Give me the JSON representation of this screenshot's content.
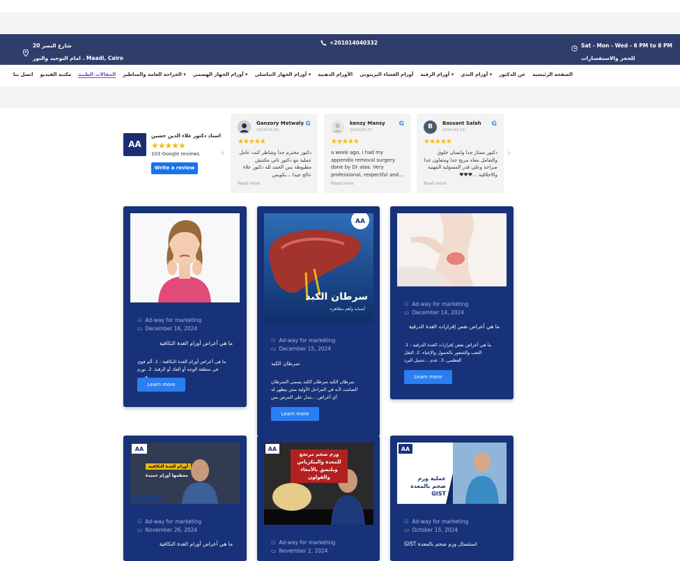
{
  "topbar": {
    "address_line1": "شارع النصر 20",
    "address_line2": "امام التوحيد والنور . Maadi, Cairo",
    "phone": "+201014040332",
    "hours_line1": "Sat - Mon - Wed - 6 PM to 8 PM",
    "hours_line2": "للحجز والاستفسارات"
  },
  "nav": {
    "items": [
      "الصفحة الرئيسية",
      "عن الدكتور",
      "أورام الثدي",
      "أورام الرقبة",
      "أورام الغشاء البريتوني",
      "الأورام الدهنية",
      "أورام الجهاز التناسلي",
      "أورام الجهاز الهضمي",
      "الجراحة العامة والمناظير",
      "المقالات الطبية",
      "مكتبة الفيديو",
      "اتصل بنا"
    ]
  },
  "reviews": {
    "logo_text": "AA",
    "business_name": "استاذ دكتور علاء الدين حسين",
    "stars": "★★★★★",
    "count": "103 Google reviews",
    "write_label": "Write a review",
    "prev_icon": "‹",
    "next_icon": "›",
    "cards": [
      {
        "avatar": "",
        "name": "Ganzory Metwaly",
        "date": "2024-03-30",
        "stars": "★★★★★",
        "text": "دكتور محترم جدا وشاطر كنت عامل عملية مع دكتور تاني مكنتش مظبوطة بس الحمد لله دكتور علاء عالج جيدا ...بكويس",
        "read": "Read more",
        "rtl": true
      },
      {
        "avatar": "",
        "name": "kenzy Mansy",
        "date": "2024-03-27",
        "stars": "★★★★★",
        "text": "a week ago, i had my appendix removal surgery done by Dr alaa. Very professional, respectful and...",
        "read": "Read more",
        "rtl": false
      },
      {
        "avatar": "B",
        "name": "Bassant Salah",
        "date": "2024-02-23",
        "stars": "★★★★★",
        "text": "دكتور ممتاز جدا وانسان خلوق والتعامل معاه مريح جدا ومتعاون جدا صراحة وعلي قدر المسؤلية المهنية والاخلاقية ...♥♥♥",
        "read": "Read more",
        "rtl": true
      }
    ]
  },
  "posts": [
    {
      "author": "Ad-way for marketing",
      "date": "December 16, 2024",
      "title": "ما هي أعراض أورام الغدة النكافية",
      "excerpt": "ما هي أعراض أورام الغدة النكافية : 1. ألم قوي في منطقة الوجه أو الفك أو الرقبة. 2. تورم في...",
      "button": "Learn more"
    },
    {
      "author": "Ad-way for marketing",
      "date": "December 15, 2024",
      "title": "سرطان الكبد",
      "excerpt": "سرطان الكبد سرطان الكبد يسمى السرطان الصامت لأنه في المراحل الأولية مش بيظهر له أي أعراض ...بتدل على المرض بس",
      "button": "Learn more",
      "image_text": "سرطان الكبد",
      "image_sub": "أسبابه وأهم مظاهره"
    },
    {
      "author": "Ad-way for marketing",
      "date": "December 14, 2024",
      "title": "ما هي أعراض نقص إفرازات الغدة الدرقية",
      "excerpt": "ما هي أعراض نقص إفرازات الغدة الدرقية : 1. التعب والشعور بالخمول والإعياء. 2. النقل العظمي. 3. عدم ...تحمل البرد",
      "button": "Learn more"
    },
    {
      "author": "Ad-way for marketing",
      "date": "November 26, 2024",
      "title": "ما هي أعراض أورام الغدة النكافية",
      "image_text": "أورام الغدة النكافية",
      "image_sub": "معظمها أورام حميدة"
    },
    {
      "author": "Ad-way for marketing",
      "date": "November 2, 2024",
      "image_text": "ورم ضخم مرتجع للمعدة والبنكرياس ويلتصق بالأمعاء والقولون"
    },
    {
      "author": "Ad-way for marketing",
      "date": "October 15, 2024",
      "title": "استئصال ورم ضخم بالمعدة GIST",
      "image_text": "عملية ورم ضخم بالمعدة GIST"
    }
  ],
  "icons": {
    "pin": "map-pin-icon",
    "phone": "phone-icon",
    "clock": "clock-icon",
    "user": "user-icon",
    "calendar": "calendar-icon"
  },
  "colors": {
    "topbar": "#2f3d6b",
    "card": "#173278",
    "button": "#2b7ef0",
    "star": "#f6bb06",
    "active_nav": "#6a4fb5"
  }
}
